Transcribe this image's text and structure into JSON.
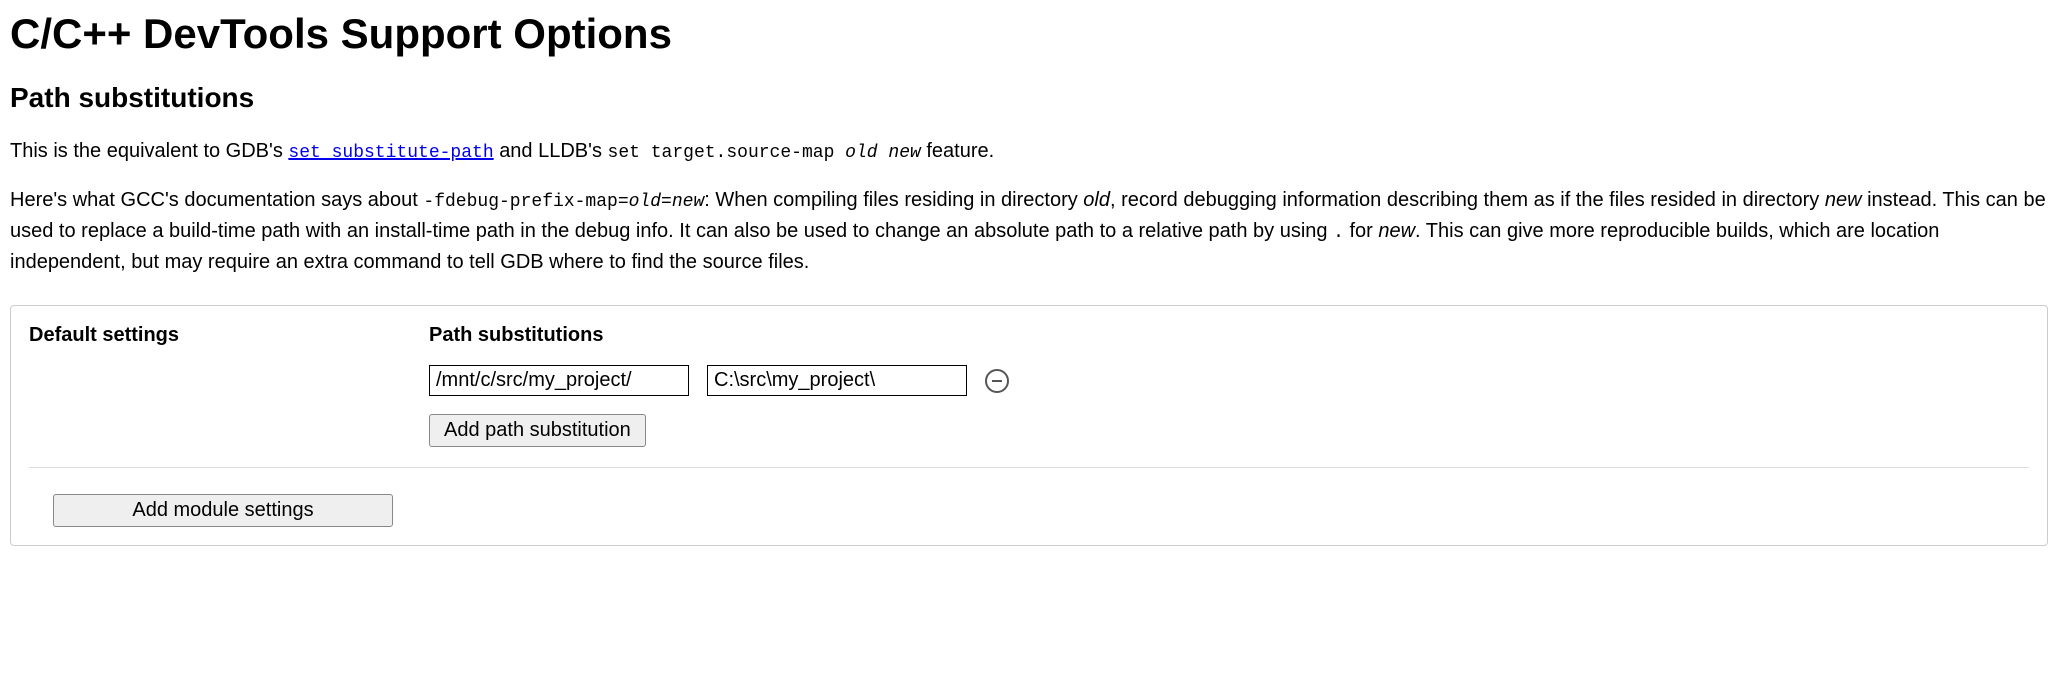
{
  "title": "C/C++ DevTools Support Options",
  "section_heading": "Path substitutions",
  "intro": {
    "prefix": "This is the equivalent to GDB's ",
    "gdb_link_text": "set substitute-path",
    "middle": " and LLDB's ",
    "lldb_code": "set target.source-map ",
    "lldb_old": "old",
    "lldb_space": " ",
    "lldb_new": "new",
    "suffix": " feature."
  },
  "doc": {
    "p1": "Here's what GCC's documentation says about ",
    "flag": "-fdebug-prefix-map=",
    "old": "old",
    "eq": "=",
    "new": "new",
    "p2": ": When compiling files residing in directory ",
    "old2": "old",
    "p3": ", record debugging information describing them as if the files resided in directory ",
    "new2": "new",
    "p4": " instead. This can be used to replace a build-time path with an install-time path in the debug info. It can also be used to change an absolute path to a relative path by using ",
    "dot": ".",
    "p5": " for ",
    "new3": "new",
    "p6": ". This can give more reproducible builds, which are location independent, but may require an extra command to tell GDB where to find the source files."
  },
  "panel": {
    "default_settings_label": "Default settings",
    "path_subs_label": "Path substitutions",
    "row": {
      "from": "/mnt/c/src/my_project/",
      "to": "C:\\src\\my_project\\"
    },
    "add_path_button": "Add path substitution",
    "add_module_button": "Add module settings"
  }
}
